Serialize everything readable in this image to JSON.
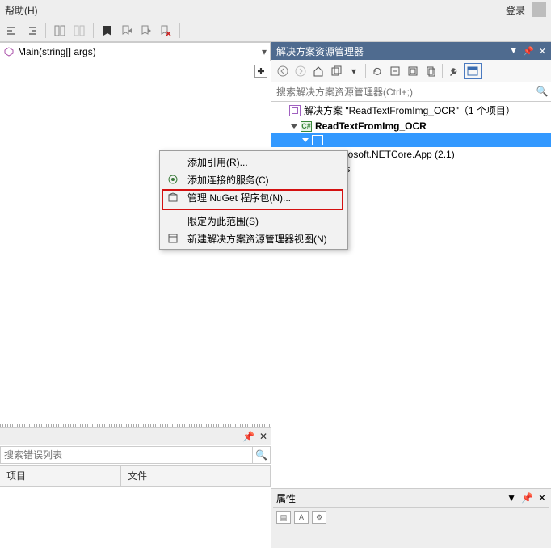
{
  "top": {
    "help": "帮助(H)",
    "login": "登录"
  },
  "code": {
    "method": "Main(string[] args)"
  },
  "solution_panel": {
    "title": "解决方案资源管理器",
    "search_placeholder": "搜索解决方案资源管理器(Ctrl+;)",
    "rows": {
      "solution": "解决方案 \"ReadTextFromImg_OCR\"（1 个项目）",
      "project": "ReadTextFromImg_OCR",
      "dep_ref": "icrosoft.NETCore.App (2.1)",
      "file_tail": ".cs"
    }
  },
  "context_menu": {
    "items": {
      "addRef": "添加引用(R)...",
      "addService": "添加连接的服务(C)",
      "nuget": "管理 NuGet 程序包(N)...",
      "scope": "限定为此范围(S)",
      "newView": "新建解决方案资源管理器视图(N)"
    }
  },
  "error_panel": {
    "search_placeholder": "搜索错误列表",
    "columns": {
      "project": "项目",
      "file": "文件"
    }
  },
  "props_panel": {
    "title": "属性"
  }
}
